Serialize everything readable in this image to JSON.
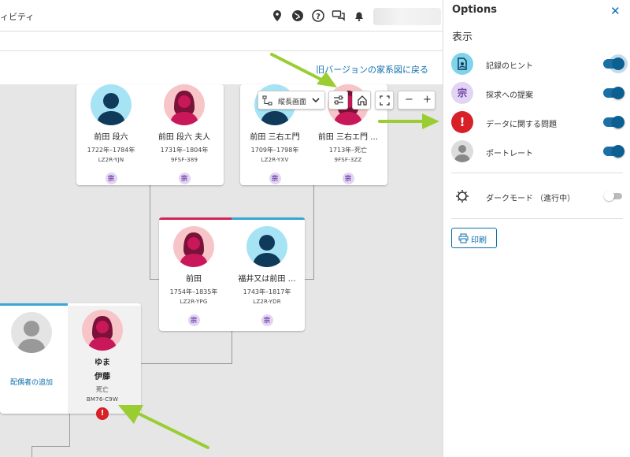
{
  "header": {
    "app_title": "ィビティ",
    "icons": [
      "map-pin-icon",
      "globe-icon",
      "help-icon",
      "chat-icon",
      "bell-icon"
    ]
  },
  "canvas": {
    "old_version_link": "旧バージョンの家系図に戻る",
    "toolbar": {
      "view_label": "縦長画面",
      "zoom_out": "−",
      "zoom_in": "+"
    },
    "hint_glyph": "宗",
    "alert_glyph": "!",
    "couple1": [
      {
        "name": "前田 段六",
        "dates": "1722年–1784年",
        "id": "LZ2R-YJN",
        "gender": "male"
      },
      {
        "name": "前田 段六 夫人",
        "dates": "1731年–1804年",
        "id": "9FSF-389",
        "gender": "female"
      }
    ],
    "couple2": [
      {
        "name": "前田 三右エ門",
        "dates": "1709年–1798年",
        "id": "LZ2R-YXV",
        "gender": "male"
      },
      {
        "name": "前田 三右エ門 …",
        "dates": "1713年–死亡",
        "id": "9FSF-3ZZ",
        "gender": "female"
      }
    ],
    "couple3": [
      {
        "name": "前田",
        "dates": "1754年–1835年",
        "id": "LZ2R-YPG",
        "gender": "female"
      },
      {
        "name": "福井又は前田 …",
        "dates": "1743年–1817年",
        "id": "LZ2R-YDR",
        "gender": "male"
      }
    ],
    "couple4": {
      "add_spouse": "配偶者の追加",
      "person": {
        "name_line1": "ゆま",
        "name_line2": "伊藤",
        "status": "死亡",
        "id": "BM76-C9W",
        "gender": "female"
      }
    }
  },
  "panel": {
    "title": "Options",
    "close_icon": "close-icon",
    "section_label": "表示",
    "options": [
      {
        "label": "記録のヒント",
        "icon": "record-hint-icon",
        "enabled": true,
        "color": "#7fd3ea"
      },
      {
        "label": "探求への提案",
        "icon": "research-suggestion-icon",
        "enabled": true,
        "color": "#e2d4f3"
      },
      {
        "label": "データに関する問題",
        "icon": "data-problem-icon",
        "enabled": true,
        "color": "#d72027"
      },
      {
        "label": "ポートレート",
        "icon": "portrait-icon",
        "enabled": true,
        "color": "#dcdcdc"
      }
    ],
    "dark_mode": {
      "label": "ダークモード （進行中）",
      "enabled": false
    },
    "print_label": "印刷"
  },
  "colors": {
    "accent": "#0c6fae",
    "toggle_on": "#1a6fa6",
    "male_bg": "#a6e3f5",
    "female_bg": "#f7c5c8",
    "alert": "#d72027",
    "annotation_arrow": "#9acd32"
  }
}
